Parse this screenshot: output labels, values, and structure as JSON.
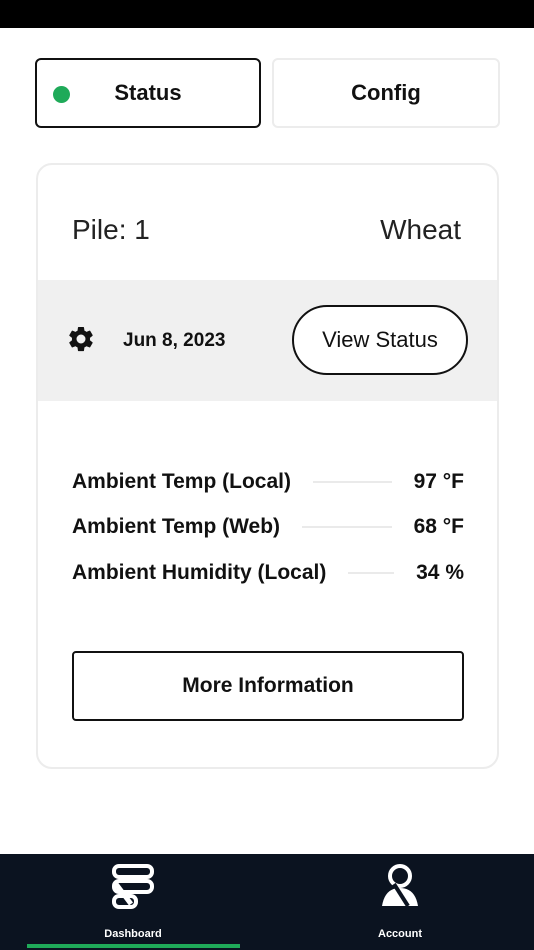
{
  "tabs": {
    "status_label": "Status",
    "config_label": "Config",
    "status_indicator_color": "#1faa59"
  },
  "card": {
    "pile": "Pile: 1",
    "crop": "Wheat",
    "date": "Jun 8, 2023",
    "view_status_label": "View Status",
    "readings": [
      {
        "label": "Ambient Temp (Local)",
        "value": "97 °F"
      },
      {
        "label": "Ambient Temp (Web)",
        "value": "68 °F"
      },
      {
        "label": "Ambient Humidity (Local)",
        "value": "34 %"
      }
    ],
    "more_info_label": "More Information"
  },
  "nav": {
    "items": [
      {
        "label": "Dashboard",
        "icon": "dashboard-icon",
        "active": true
      },
      {
        "label": "Account",
        "icon": "account-icon",
        "active": false
      }
    ],
    "active_color": "#1faa59"
  }
}
